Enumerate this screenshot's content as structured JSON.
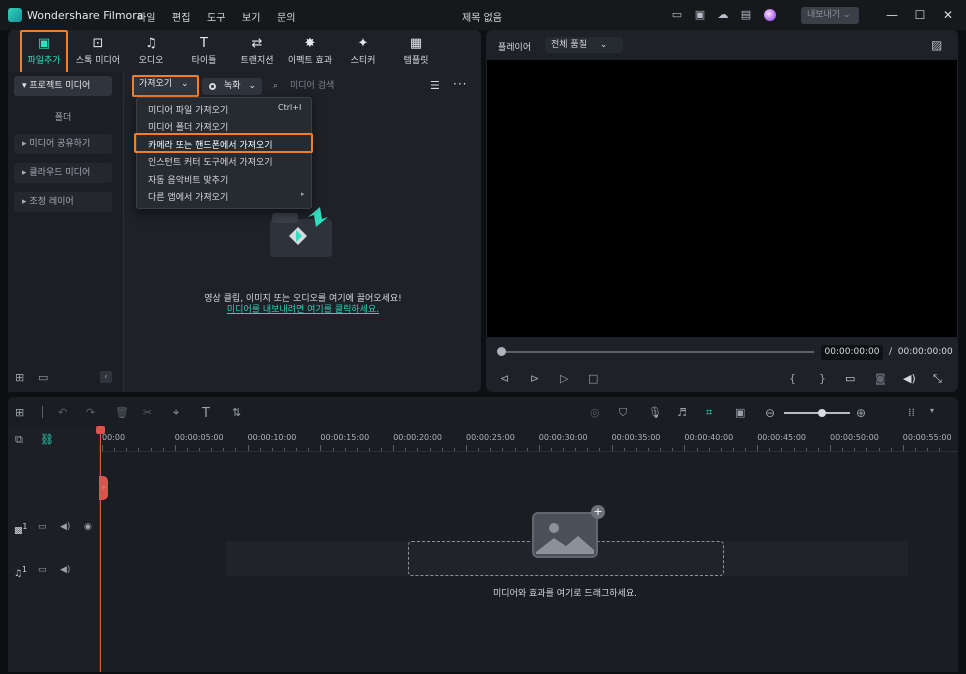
{
  "titlebar": {
    "app_title": "Wondershare Filmora",
    "menu": [
      "파일",
      "편집",
      "도구",
      "보기",
      "문의"
    ],
    "doc_title": "제목 없음",
    "export_label": "내보내기"
  },
  "toolbar": {
    "items": [
      {
        "label": "파일추가",
        "icon": "media-icon",
        "active": true
      },
      {
        "label": "스톡 미디어",
        "icon": "stock-icon"
      },
      {
        "label": "오디오",
        "icon": "music-icon"
      },
      {
        "label": "타이틀",
        "icon": "title-icon"
      },
      {
        "label": "트랜지션",
        "icon": "transition-icon"
      },
      {
        "label": "이펙트 효과",
        "icon": "effects-icon"
      },
      {
        "label": "스티커",
        "icon": "sticker-icon"
      },
      {
        "label": "템플릿",
        "icon": "template-icon"
      }
    ]
  },
  "sidebar": {
    "project_media": "프로젝트 미디어",
    "folder": "폴더",
    "items": [
      "미디어 공유하기",
      "클라우드 미디어",
      "조정 레이어"
    ]
  },
  "media": {
    "import_label": "가져오기",
    "record_label": "녹화",
    "search_placeholder": "미디어 검색",
    "empty_text": "영상 클립, 이미지 또는 오디오를 여기에 끌어오세요!",
    "empty_link": "미디어를 내보내려면 여기를 클릭하세요."
  },
  "dropdown": {
    "items": [
      {
        "label": "미디어 파일 가져오기",
        "shortcut": "Ctrl+I"
      },
      {
        "label": "미디어 폴더 가져오기",
        "shortcut": ""
      },
      {
        "label": "카메라 또는 핸드폰에서 가져오기",
        "shortcut": "",
        "highlighted": true
      },
      {
        "label": "인스턴트 커터 도구에서 가져오기",
        "shortcut": ""
      },
      {
        "label": "자동 음악비트 맞추기",
        "shortcut": ""
      },
      {
        "label": "다른 앱에서 가져오기",
        "shortcut": "",
        "submenu": true
      }
    ]
  },
  "player": {
    "label": "플레이어",
    "quality": "전체 품질",
    "current_time": "00:00:00:00",
    "separator": "/",
    "total_time": "00:00:00:00",
    "progress": 0
  },
  "timeline": {
    "ticks": [
      "00:00",
      "00:00:05:00",
      "00:00:10:00",
      "00:00:15:00",
      "00:00:20:00",
      "00:00:25:00",
      "00:00:30:00",
      "00:00:35:00",
      "00:00:40:00",
      "00:00:45:00",
      "00:00:50:00",
      "00:00:55:00"
    ],
    "drop_text": "미디어와 효과를 여기로 드래그하세요.",
    "video_track": "1",
    "audio_track": "1"
  },
  "colors": {
    "accent": "#2fe0c0",
    "highlight_box": "#f07f2a",
    "playhead": "#e0524e"
  }
}
